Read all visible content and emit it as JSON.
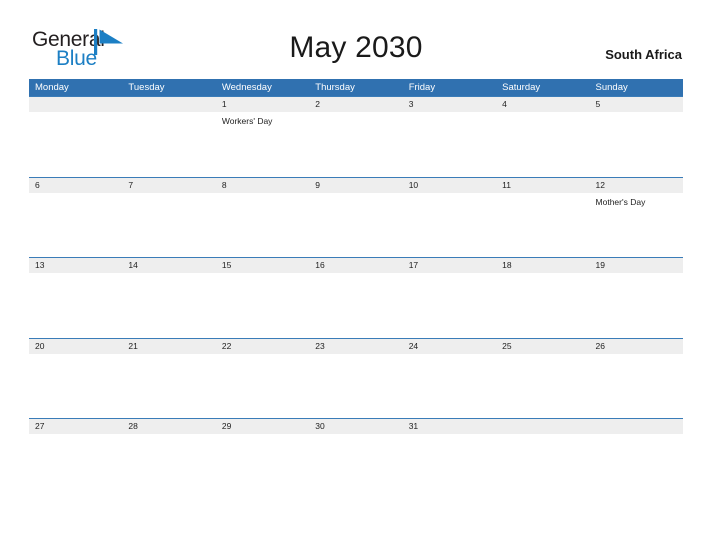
{
  "brand": {
    "name_part1": "General",
    "name_part2": "Blue",
    "flag_color": "#1c7fc4",
    "text_color": "#231f20"
  },
  "header": {
    "title": "May 2030",
    "region": "South Africa",
    "accent_color": "#3071b0",
    "date_strip_color": "#eeeeee"
  },
  "weekdays": [
    "Monday",
    "Tuesday",
    "Wednesday",
    "Thursday",
    "Friday",
    "Saturday",
    "Sunday"
  ],
  "weeks": [
    {
      "days": [
        {
          "date": "",
          "event": ""
        },
        {
          "date": "",
          "event": ""
        },
        {
          "date": "1",
          "event": "Workers' Day"
        },
        {
          "date": "2",
          "event": ""
        },
        {
          "date": "3",
          "event": ""
        },
        {
          "date": "4",
          "event": ""
        },
        {
          "date": "5",
          "event": ""
        }
      ]
    },
    {
      "days": [
        {
          "date": "6",
          "event": ""
        },
        {
          "date": "7",
          "event": ""
        },
        {
          "date": "8",
          "event": ""
        },
        {
          "date": "9",
          "event": ""
        },
        {
          "date": "10",
          "event": ""
        },
        {
          "date": "11",
          "event": ""
        },
        {
          "date": "12",
          "event": "Mother's Day"
        }
      ]
    },
    {
      "days": [
        {
          "date": "13",
          "event": ""
        },
        {
          "date": "14",
          "event": ""
        },
        {
          "date": "15",
          "event": ""
        },
        {
          "date": "16",
          "event": ""
        },
        {
          "date": "17",
          "event": ""
        },
        {
          "date": "18",
          "event": ""
        },
        {
          "date": "19",
          "event": ""
        }
      ]
    },
    {
      "days": [
        {
          "date": "20",
          "event": ""
        },
        {
          "date": "21",
          "event": ""
        },
        {
          "date": "22",
          "event": ""
        },
        {
          "date": "23",
          "event": ""
        },
        {
          "date": "24",
          "event": ""
        },
        {
          "date": "25",
          "event": ""
        },
        {
          "date": "26",
          "event": ""
        }
      ]
    },
    {
      "days": [
        {
          "date": "27",
          "event": ""
        },
        {
          "date": "28",
          "event": ""
        },
        {
          "date": "29",
          "event": ""
        },
        {
          "date": "30",
          "event": ""
        },
        {
          "date": "31",
          "event": ""
        },
        {
          "date": "",
          "event": ""
        },
        {
          "date": "",
          "event": ""
        }
      ]
    }
  ]
}
